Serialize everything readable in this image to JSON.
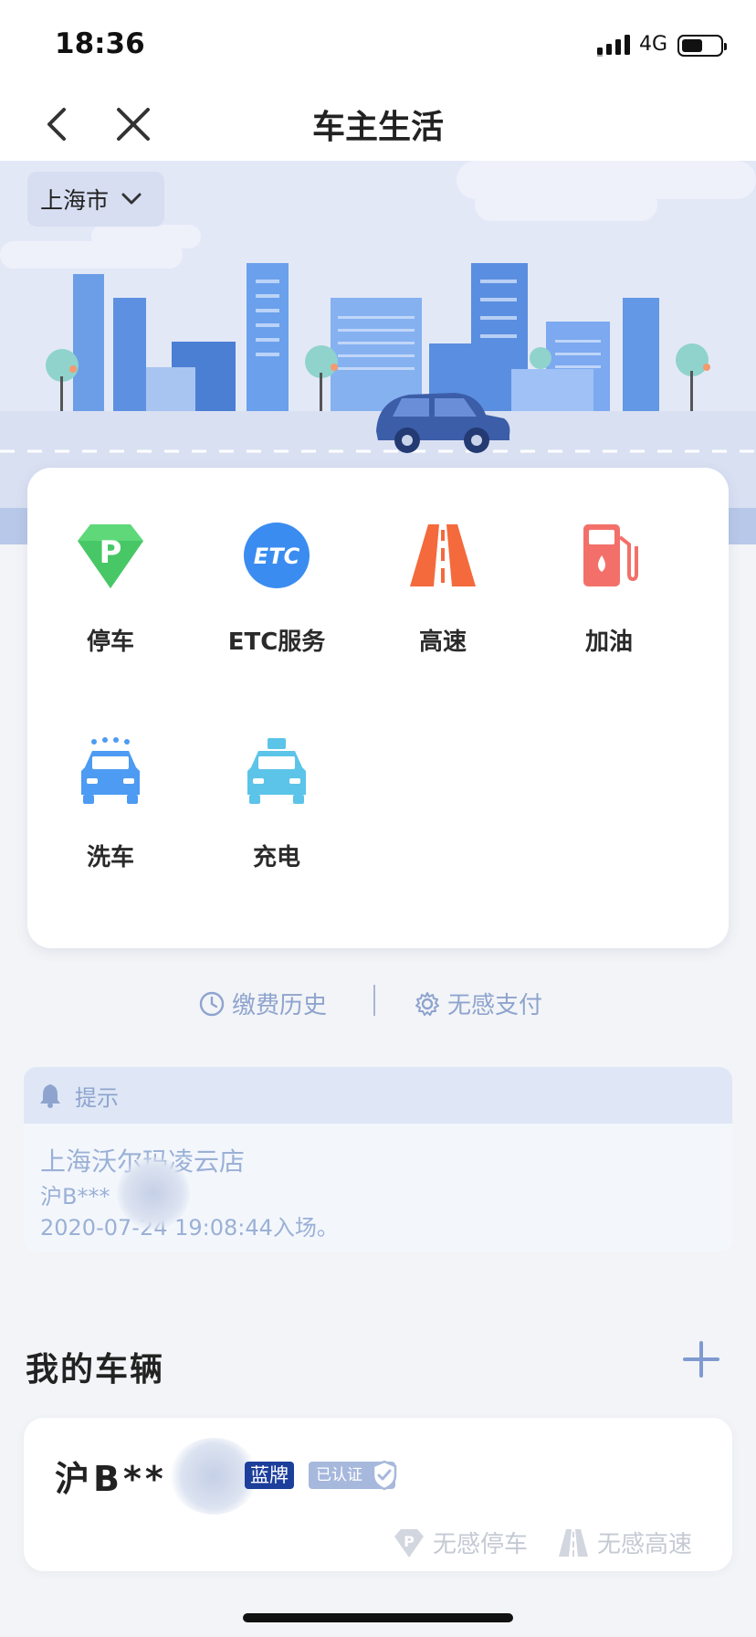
{
  "status_bar": {
    "time": "18:36",
    "network": "4G"
  },
  "nav": {
    "title": "车主生活"
  },
  "banner": {
    "city": "上海市"
  },
  "services": [
    {
      "label": "停车",
      "icon": "parking-icon"
    },
    {
      "label": "ETC服务",
      "icon": "etc-icon"
    },
    {
      "label": "高速",
      "icon": "highway-icon"
    },
    {
      "label": "加油",
      "icon": "fuel-icon"
    },
    {
      "label": "洗车",
      "icon": "car-wash-icon"
    },
    {
      "label": "充电",
      "icon": "charging-icon"
    }
  ],
  "links": {
    "history": "缴费历史",
    "seamless_pay": "无感支付"
  },
  "notice": {
    "header": "提示",
    "store": "上海沃尔玛凌云店",
    "plate": "沪B***",
    "entry": "2020-07-24 19:08:44入场。"
  },
  "vehicles": {
    "title": "我的车辆",
    "items": [
      {
        "plate": "沪B**",
        "plate_type": "蓝牌",
        "status": "已认证",
        "features": [
          "无感停车",
          "无感高速"
        ]
      }
    ]
  },
  "colors": {
    "accent": "#8ea4cf",
    "banner_bg": "#e3e8f7",
    "plate_blue": "#1c3f9c",
    "parking_green": "#5fd87a",
    "etc_blue": "#3a8cf0",
    "highway_orange": "#f46a3c",
    "fuel_red": "#f3706a"
  }
}
